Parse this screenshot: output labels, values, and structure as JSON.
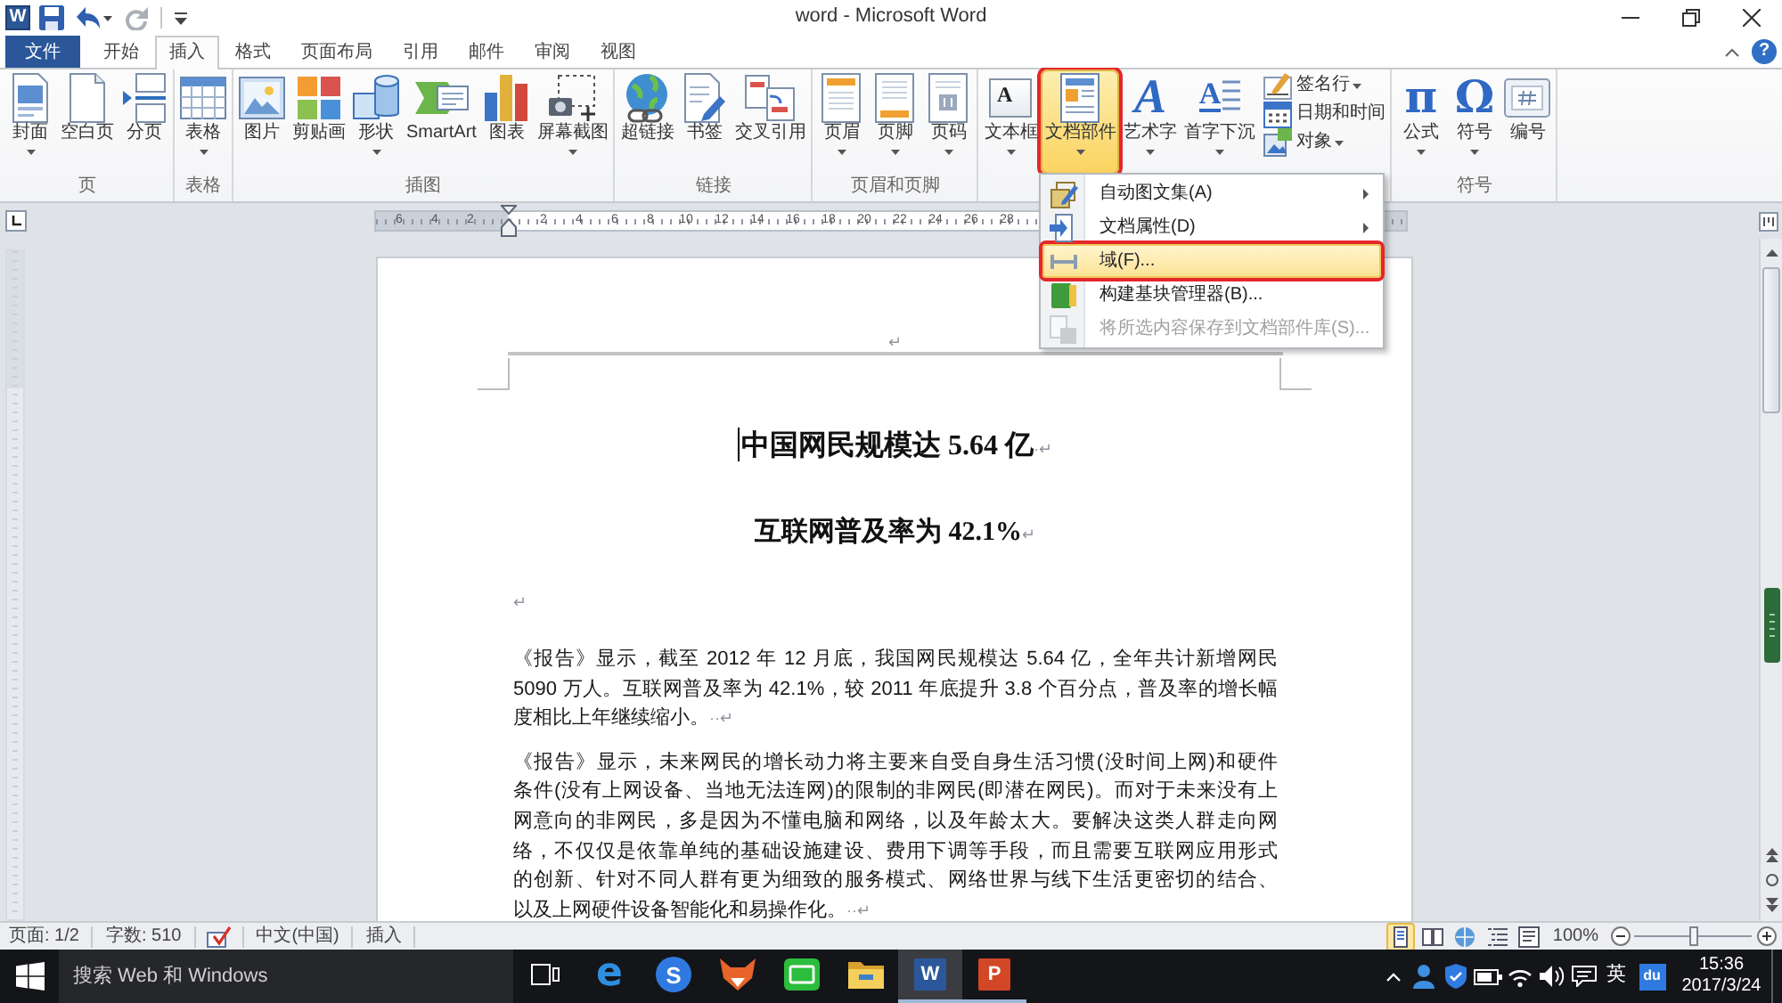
{
  "window": {
    "app_glyph": "W",
    "title": "word - Microsoft Word",
    "help_glyph": "?"
  },
  "quick_access": [
    {
      "disabled": false,
      "dropdown": false
    },
    {
      "disabled": false,
      "dropdown": true
    },
    {
      "disabled": true,
      "dropdown": false
    }
  ],
  "tabs": [
    {
      "label": "文件",
      "kind": "file",
      "selected": false
    },
    {
      "label": "开始",
      "kind": "tab",
      "selected": false
    },
    {
      "label": "插入",
      "kind": "tab",
      "selected": true
    },
    {
      "label": "格式",
      "kind": "tab",
      "selected": false
    },
    {
      "label": "页面布局",
      "kind": "tab",
      "selected": false
    },
    {
      "label": "引用",
      "kind": "tab",
      "selected": false
    },
    {
      "label": "邮件",
      "kind": "tab",
      "selected": false
    },
    {
      "label": "审阅",
      "kind": "tab",
      "selected": false
    },
    {
      "label": "视图",
      "kind": "tab",
      "selected": false
    }
  ],
  "ribbon": {
    "groups": [
      {
        "label": "页",
        "buttons": [
          {
            "label": "封面",
            "kind": "large",
            "dropdown": true,
            "active": false,
            "annotated": false
          },
          {
            "label": "空白页",
            "kind": "large",
            "dropdown": false,
            "active": false,
            "annotated": false
          },
          {
            "label": "分页",
            "kind": "large",
            "dropdown": false,
            "active": false,
            "annotated": false
          }
        ]
      },
      {
        "label": "表格",
        "buttons": [
          {
            "label": "表格",
            "kind": "large",
            "dropdown": true,
            "active": false,
            "annotated": false
          }
        ]
      },
      {
        "label": "插图",
        "buttons": [
          {
            "label": "图片",
            "kind": "large",
            "dropdown": false,
            "active": false,
            "annotated": false
          },
          {
            "label": "剪贴画",
            "kind": "large",
            "dropdown": false,
            "active": false,
            "annotated": false
          },
          {
            "label": "形状",
            "kind": "large",
            "dropdown": true,
            "active": false,
            "annotated": false
          },
          {
            "label": "SmartArt",
            "kind": "large",
            "dropdown": false,
            "active": false,
            "annotated": false
          },
          {
            "label": "图表",
            "kind": "large",
            "dropdown": false,
            "active": false,
            "annotated": false
          },
          {
            "label": "屏幕截图",
            "kind": "large",
            "dropdown": true,
            "active": false,
            "annotated": false
          }
        ]
      },
      {
        "label": "链接",
        "buttons": [
          {
            "label": "超链接",
            "kind": "large",
            "dropdown": false,
            "active": false,
            "annotated": false
          },
          {
            "label": "书签",
            "kind": "large",
            "dropdown": false,
            "active": false,
            "annotated": false
          },
          {
            "label": "交叉引用",
            "kind": "large",
            "dropdown": false,
            "active": false,
            "annotated": false
          }
        ]
      },
      {
        "label": "页眉和页脚",
        "buttons": [
          {
            "label": "页眉",
            "kind": "large",
            "dropdown": true,
            "active": false,
            "annotated": false
          },
          {
            "label": "页脚",
            "kind": "large",
            "dropdown": true,
            "active": false,
            "annotated": false
          },
          {
            "label": "页码",
            "kind": "large",
            "dropdown": true,
            "active": false,
            "annotated": false
          }
        ]
      },
      {
        "buttons": [
          {
            "label": "文本框",
            "kind": "large",
            "glyph": "A",
            "dropdown": true,
            "active": false,
            "annotated": false
          },
          {
            "label": "文档部件",
            "kind": "large",
            "dropdown": true,
            "active": true,
            "annotated": true
          },
          {
            "label": "艺术字",
            "kind": "large",
            "glyph": "A",
            "dropdown": true,
            "active": false,
            "annotated": false
          },
          {
            "label": "首字下沉",
            "kind": "large",
            "glyph": "A",
            "dropdown": true,
            "active": false,
            "annotated": false
          },
          {
            "label": "签名行",
            "kind": "small",
            "dropdown": true,
            "active": false,
            "annotated": false
          },
          {
            "label": "日期和时间",
            "kind": "small",
            "dropdown": false,
            "active": false,
            "annotated": false
          },
          {
            "label": "对象",
            "kind": "small",
            "dropdown": true,
            "active": false,
            "annotated": false
          }
        ]
      },
      {
        "label": "符号",
        "buttons": [
          {
            "label": "公式",
            "kind": "large",
            "glyph": "π",
            "dropdown": true,
            "active": false,
            "annotated": false
          },
          {
            "label": "符号",
            "kind": "large",
            "glyph": "Ω",
            "dropdown": true,
            "active": false,
            "annotated": false
          },
          {
            "label": "编号",
            "kind": "large",
            "dropdown": false,
            "active": false,
            "annotated": false
          }
        ]
      }
    ]
  },
  "ruler": {
    "left_labels": [
      "6",
      "4",
      "2"
    ],
    "labels": [
      "2",
      "4",
      "6",
      "8",
      "10",
      "12",
      "14",
      "16",
      "18",
      "20",
      "22",
      "24",
      "26",
      "28"
    ]
  },
  "document": {
    "header_mark": "↵",
    "title": {
      "text": "中国网民规模达 5.64 亿",
      "mark": "·↵"
    },
    "subtitle": {
      "text": "互联网普及率为 42.1%",
      "mark": "↵"
    },
    "empty_mark": "↵",
    "paragraphs": [
      {
        "lines": [
          "《报告》显示，截至 2012 年 12 月底，我国网民规模达 5.64 亿，全年共计新增网民",
          "5090 万人。互联网普及率为 42.1%，较 2011 年底提升 3.8 个百分点，普及率的增长幅",
          "度相比上年继续缩小。"
        ],
        "mark": "··↵"
      },
      {
        "lines": [
          "《报告》显示，未来网民的增长动力将主要来自受自身生活习惯(没时间上网)和硬件",
          "条件(没有上网设备、当地无法连网)的限制的非网民(即潜在网民)。而对于未来没有上",
          "网意向的非网民，多是因为不懂电脑和网络，以及年龄太大。要解决这类人群走向网",
          "络，不仅仅是依靠单纯的基础设施建设、费用下调等手段，而且需要互联网应用形式",
          "的创新、针对不同人群有更为细致的服务模式、网络世界与线下生活更密切的结合、",
          "以及上网硬件设备智能化和易操作化。"
        ],
        "mark": "··↵"
      }
    ]
  },
  "menu": {
    "items": [
      {
        "label": "自动图文集(A)",
        "submenu": true,
        "selected": false,
        "disabled": false,
        "annotated": false
      },
      {
        "label": "文档属性(D)",
        "submenu": true,
        "selected": false,
        "disabled": false,
        "annotated": false
      },
      {
        "label": "域(F)...",
        "submenu": false,
        "selected": true,
        "disabled": false,
        "annotated": true
      },
      {
        "label": "构建基块管理器(B)...",
        "submenu": false,
        "selected": false,
        "disabled": false,
        "annotated": false
      },
      {
        "label": "将所选内容保存到文档部件库(S)...",
        "submenu": false,
        "selected": false,
        "disabled": true,
        "annotated": false
      }
    ]
  },
  "status_bar": {
    "items": [
      {
        "kind": "text",
        "text": "页面: 1/2"
      },
      {
        "kind": "text",
        "text": "字数: 510"
      },
      {
        "kind": "proofing"
      },
      {
        "kind": "text",
        "text": "中文(中国)"
      },
      {
        "kind": "text",
        "text": "插入"
      }
    ],
    "views": [
      {
        "selected": true
      },
      {
        "selected": false
      },
      {
        "selected": false
      },
      {
        "selected": false
      },
      {
        "selected": false
      }
    ],
    "zoom": {
      "reading": "100%",
      "level": 0.5
    }
  },
  "taskbar": {
    "search": {
      "placeholder": "搜索 Web 和 Windows"
    },
    "apps": [
      {
        "glyph": "e",
        "running": false,
        "active": false
      },
      {
        "glyph": "S",
        "running": false,
        "active": false
      },
      {
        "running": false,
        "active": false
      },
      {
        "running": false,
        "active": false
      },
      {
        "running": false,
        "active": false
      },
      {
        "glyph": "W",
        "running": true,
        "active": true
      },
      {
        "glyph": "P",
        "running": true,
        "active": false
      }
    ],
    "tray": {
      "ime": "英",
      "badge": "du",
      "time": "15:36",
      "date": "2017/3/24"
    }
  }
}
